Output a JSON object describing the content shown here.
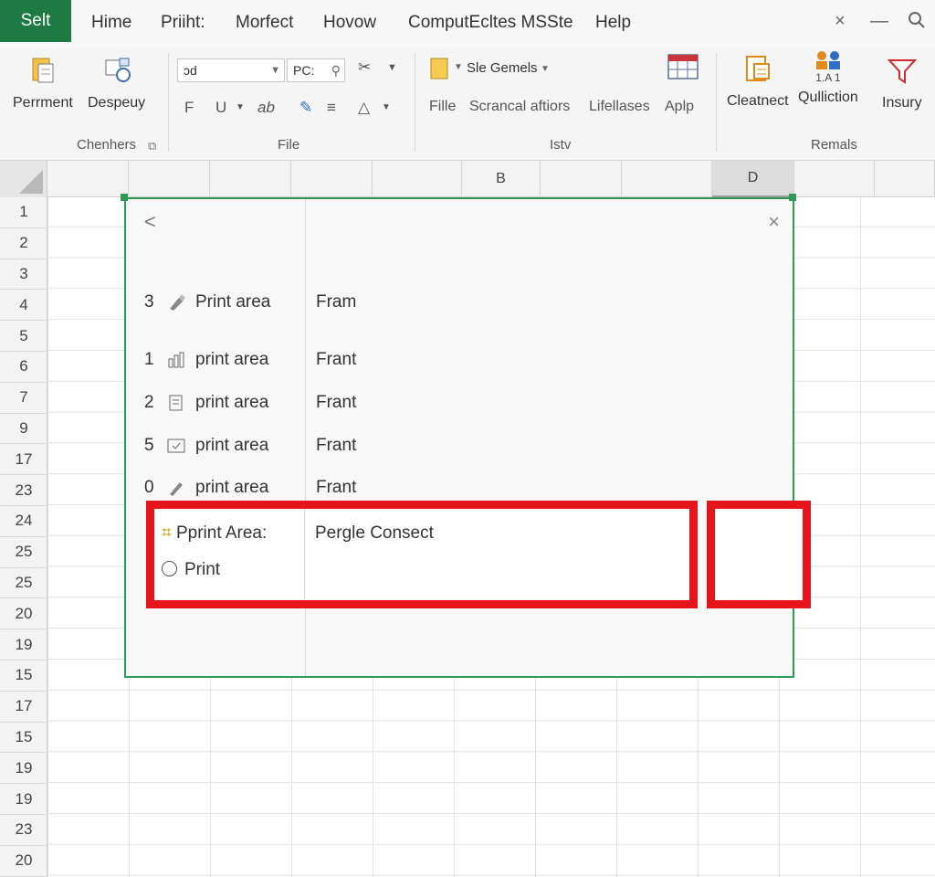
{
  "menubar": {
    "active_tab": "Selt",
    "items": [
      "Hime",
      "Priiht:",
      "Morfect",
      "Hovow",
      "ComputEcltes MSSte",
      "Help"
    ],
    "close_glyph": "×",
    "minimize_glyph": "—",
    "search_glyph": "⚲"
  },
  "ribbon": {
    "group1": {
      "buttons": [
        {
          "label": "Perrment",
          "icon": "paste-icon"
        },
        {
          "label": "Despeuy",
          "icon": "format-painter-icon"
        }
      ],
      "label": "Chenhers",
      "launcher": "⧉"
    },
    "group2": {
      "font_combo": "ɔd",
      "size_combo": "PC:",
      "label": "File",
      "glyphs": [
        "F",
        "U",
        "ab",
        "A",
        "≡",
        "△"
      ]
    },
    "group3": {
      "style_combo": "Sle Gemels",
      "items": [
        "Fille",
        "Scrancal aftiors",
        "Lifellases",
        "Aplp"
      ],
      "label": "Istv"
    },
    "group4": {
      "buttons": [
        {
          "label": "Cleatnect",
          "icon": "clipboard-icon"
        },
        {
          "label": "Qulliction",
          "icon": "people-icon",
          "sub": "1.A 1"
        },
        {
          "label": "Insury",
          "icon": "funnel-icon"
        }
      ],
      "label": "Remals"
    }
  },
  "sheet": {
    "columns": [
      {
        "label": "",
        "selected": false
      },
      {
        "label": "",
        "selected": false
      },
      {
        "label": "",
        "selected": false
      },
      {
        "label": "",
        "selected": false
      },
      {
        "label": "",
        "selected": false
      },
      {
        "label": "B",
        "selected": false
      },
      {
        "label": "",
        "selected": false
      },
      {
        "label": "",
        "selected": false
      },
      {
        "label": "D",
        "selected": true
      },
      {
        "label": "",
        "selected": false
      },
      {
        "label": "",
        "selected": false
      }
    ],
    "rows": [
      "1",
      "2",
      "3",
      "4",
      "5",
      "6",
      "7",
      "9",
      "17",
      "23",
      "24",
      "25",
      "25",
      "20",
      "19",
      "15",
      "17",
      "15",
      "19",
      "19",
      "23",
      "20"
    ]
  },
  "dialog": {
    "back_glyph": "<",
    "close_glyph": "×",
    "rows": [
      {
        "num": "3",
        "icon": "brush-icon",
        "name": "Print area",
        "value": "Fram"
      },
      {
        "num": "1",
        "icon": "columns-icon",
        "name": "print area",
        "value": "Frant"
      },
      {
        "num": "2",
        "icon": "document-icon",
        "name": "print area",
        "value": "Frant"
      },
      {
        "num": "5",
        "icon": "page-icon",
        "name": "print area",
        "value": "Frant"
      },
      {
        "num": "0",
        "icon": "pen-icon",
        "name": "print area",
        "value": "Frant"
      }
    ],
    "highlight": {
      "title_prefix": "⌗",
      "title": "Pprint Area:",
      "option": "Print",
      "value": "Pergle Consect"
    }
  }
}
